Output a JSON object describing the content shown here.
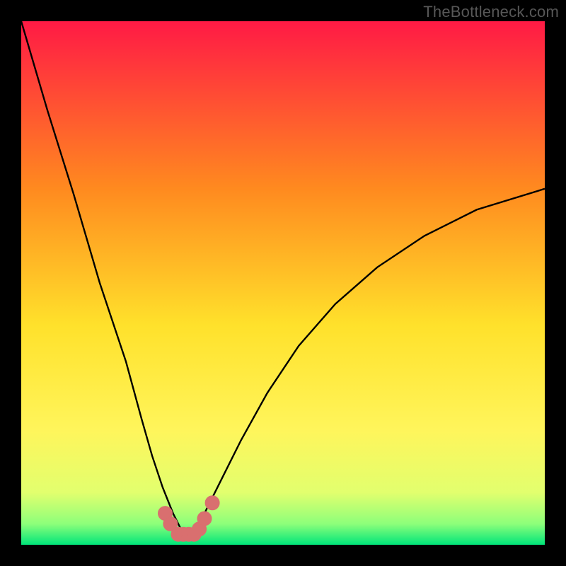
{
  "watermark": {
    "text": "TheBottleneck.com"
  },
  "colors": {
    "frame": "#000000",
    "curve_stroke": "#000000",
    "marker_fill": "#d96f6f",
    "marker_stroke": "#d96f6f",
    "grad_top": "#ff1a45",
    "grad_mid1": "#ff8a1f",
    "grad_mid2": "#ffe12b",
    "grad_mid3": "#fff55b",
    "grad_low": "#e2ff6e",
    "grad_green": "#00e57a"
  },
  "chart_data": {
    "type": "line",
    "title": "",
    "xlabel": "",
    "ylabel": "",
    "x": [
      0,
      5,
      10,
      15,
      20,
      23,
      25,
      27,
      29,
      30.5,
      32,
      33.5,
      35,
      38,
      42,
      47,
      53,
      60,
      68,
      77,
      87,
      100
    ],
    "values": [
      100,
      83,
      67,
      50,
      35,
      24,
      17,
      11,
      6,
      3,
      2,
      3,
      6,
      12,
      20,
      29,
      38,
      46,
      53,
      59,
      64,
      68
    ],
    "xlim": [
      0,
      100
    ],
    "ylim": [
      0,
      100
    ],
    "markers": {
      "x": [
        27.5,
        28.5,
        30,
        31,
        32,
        33,
        34,
        35,
        36.5
      ],
      "y": [
        6,
        4,
        2,
        2,
        2,
        2,
        3,
        5,
        8
      ]
    }
  }
}
